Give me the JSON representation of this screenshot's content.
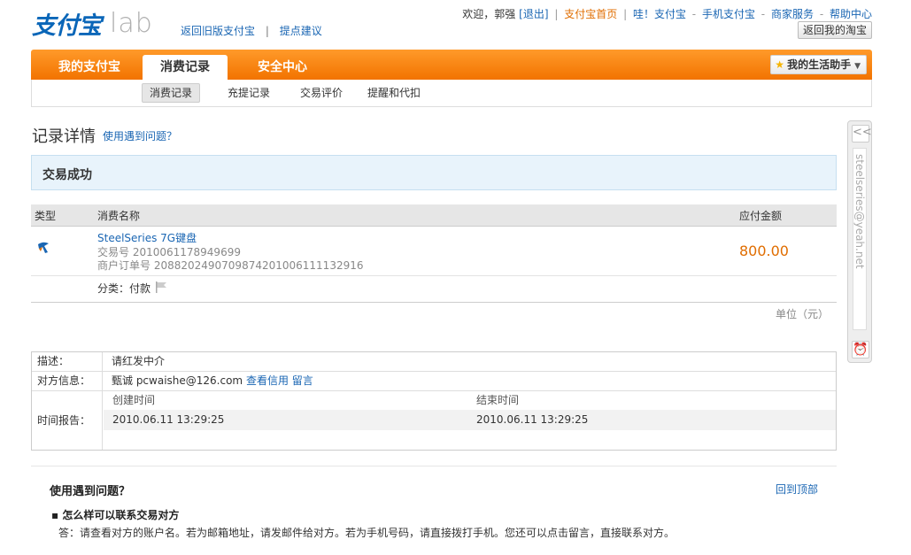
{
  "header": {
    "logo_main": "支付宝",
    "logo_lab": "lab",
    "old_version": "返回旧版支付宝",
    "suggest": "提点建议",
    "sep": "|",
    "welcome": "欢迎，郭强",
    "logout": "[退出]",
    "links": [
      "支付宝首页",
      "哇！支付宝",
      "手机支付宝",
      "商家服务",
      "帮助中心"
    ],
    "link_sep": "|",
    "link_dash": "-",
    "back_taobao": "返回我的淘宝"
  },
  "nav": {
    "tabs": [
      "我的支付宝",
      "消费记录",
      "安全中心"
    ],
    "active_tab": "消费记录",
    "assistant": "我的生活助手"
  },
  "subnav": {
    "items": [
      "消费记录",
      "充提记录",
      "交易评价",
      "提醒和代扣"
    ]
  },
  "page": {
    "title": "记录详情",
    "help": "使用遇到问题？",
    "status": "交易成功"
  },
  "table": {
    "headers": {
      "type": "类型",
      "name": "消费名称",
      "amount": "应付金额"
    },
    "row": {
      "name": "SteelSeries 7G键盘",
      "trade_no": "交易号 2010061178949699",
      "merchant_no": "商户订单号 2088202490709874201006111132916",
      "amount": "800.00",
      "category": "分类：付款"
    },
    "unit": "单位（元）"
  },
  "info": {
    "desc_label": "描述：",
    "desc_value": "请红发中介",
    "party_label": "对方信息：",
    "party_name": "甄诚 pcwaishe@126.com",
    "credit_link": "查看信用",
    "message_link": "留言",
    "time_label": "时间报告：",
    "created_label": "创建时间",
    "ended_label": "结束时间",
    "created_value": "2010.06.11 13:29:25",
    "ended_value": "2010.06.11 13:29:25"
  },
  "side": {
    "email": "steelseries@yeah.net",
    "collapse": "<<"
  },
  "faq": {
    "title": "使用遇到问题？",
    "back_top": "回到顶部",
    "q": "怎么样可以联系交易对方",
    "a": "答：请查看对方的账户名。若为邮箱地址，请发邮件给对方。若为手机号码，请直接拨打手机。您还可以点击留言，直接联系对方。"
  },
  "colors": {
    "orange": "#f27300",
    "link": "#1a66b3",
    "amount": "#e06d00"
  }
}
